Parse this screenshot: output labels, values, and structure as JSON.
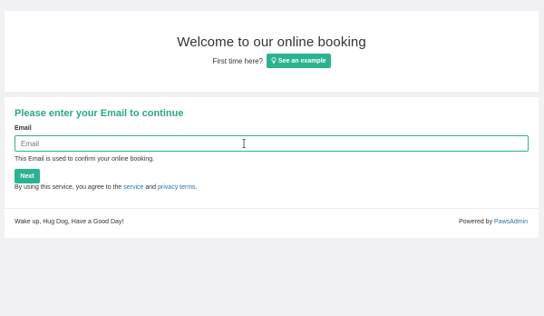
{
  "welcome": {
    "title": "Welcome to our online booking",
    "first_time_text": "First time here?",
    "example_button_label": "See an example"
  },
  "form": {
    "heading": "Please enter your Email to continue",
    "email_label": "Email",
    "email_placeholder": "Email",
    "email_value": "",
    "help_text": "This Email is used to confirm your online booking.",
    "next_button_label": "Next",
    "terms_prefix": "By using this service, you agree to the",
    "service_link": "service",
    "and_text": "and",
    "privacy_link": "privacy terms",
    "terms_suffix": "."
  },
  "footer": {
    "tagline": "Wake up, Hug Dog, Have a Good Day!",
    "powered_by_text": "Powered by",
    "powered_by_link": "PawsAdmin"
  },
  "icons": {
    "example_button_icon": "lightbulb-icon",
    "cursor_icon": "text-cursor-icon"
  },
  "colors": {
    "accent": "#2bb391",
    "heading_green": "#2ba689",
    "link_blue": "#2a72a8",
    "background": "#f1f1f3"
  }
}
